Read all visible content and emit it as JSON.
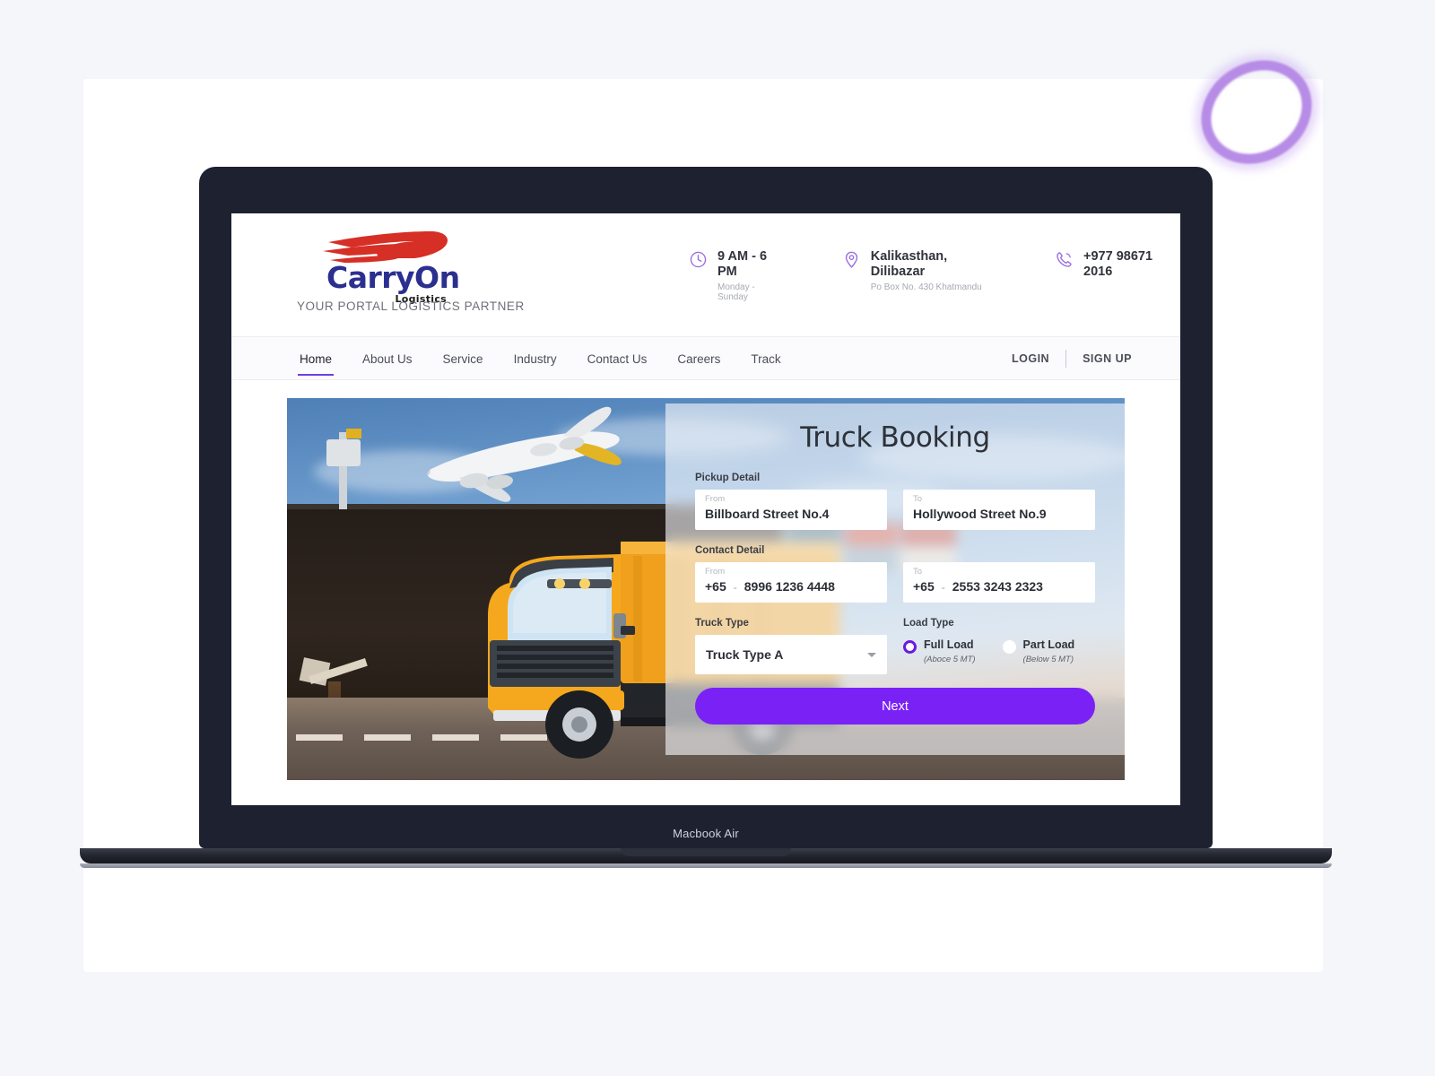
{
  "device": {
    "label": "Macbook Air"
  },
  "site": {
    "logo": {
      "word_part1": "Carry",
      "word_part2": "On",
      "sub": "Logistics",
      "icon": "wing-icon"
    },
    "tagline": "YOUR PORTAL LOGISTICS PARTNER",
    "info_items": [
      {
        "icon": "clock-icon",
        "title": "9 AM - 6 PM",
        "sub": "Monday - Sunday"
      },
      {
        "icon": "location-pin-icon",
        "title": "Kalikasthan, Dilibazar",
        "sub": "Po Box No. 430 Khatmandu"
      },
      {
        "icon": "phone-icon",
        "title": "+977 98671 2016",
        "sub": ""
      }
    ],
    "nav": {
      "items": [
        {
          "label": "Home",
          "active": true
        },
        {
          "label": "About Us",
          "active": false
        },
        {
          "label": "Service",
          "active": false
        },
        {
          "label": "Industry",
          "active": false
        },
        {
          "label": "Contact Us",
          "active": false
        },
        {
          "label": "Careers",
          "active": false
        },
        {
          "label": "Track",
          "active": false
        }
      ],
      "login": "LOGIN",
      "signup": "SIGN UP",
      "active_underline_color": "#6d3fe0"
    }
  },
  "booking": {
    "title": "Truck Booking",
    "pickup_label": "Pickup Detail",
    "pickup_from": {
      "caption": "From",
      "value": "Billboard Street No.4"
    },
    "pickup_to": {
      "caption": "To",
      "value": "Hollywood Street No.9"
    },
    "contact_label": "Contact Detail",
    "contact_from": {
      "caption": "From",
      "code": "+65",
      "sep": "-",
      "value": "8996 1236 4448"
    },
    "contact_to": {
      "caption": "To",
      "code": "+65",
      "sep": "-",
      "value": "2553 3243 2323"
    },
    "truck_type_label": "Truck Type",
    "truck_type_value": "Truck Type A",
    "load_type_label": "Load Type",
    "load_options": [
      {
        "label": "Full Load",
        "sub": "(Aboce 5 MT)",
        "selected": true
      },
      {
        "label": "Part Load",
        "sub": "(Below 5 MT)",
        "selected": false
      }
    ],
    "next_label": "Next",
    "accent_color": "#7a22f5"
  }
}
